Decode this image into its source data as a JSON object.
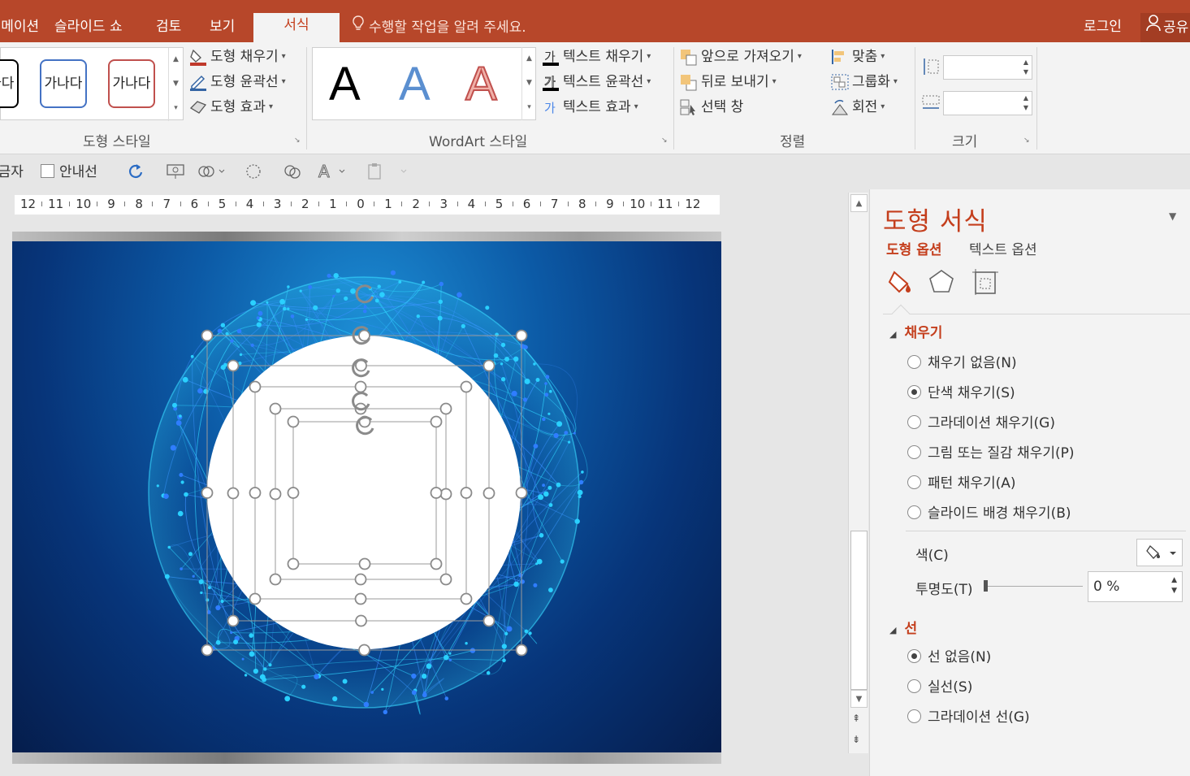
{
  "tabs": [
    {
      "label": "애니메이션"
    },
    {
      "label": "슬라이드 쇼"
    },
    {
      "label": "검토"
    },
    {
      "label": "보기"
    },
    {
      "label": "서식",
      "active": true
    }
  ],
  "tell_me": "수행할 작업을 알려 주세요.",
  "login": "로그인",
  "share": "공유",
  "ribbon": {
    "shape_styles": {
      "swatches": [
        "가나다",
        "가나다",
        "가나다"
      ],
      "fill": "도형 채우기",
      "outline": "도형 윤곽선",
      "effects": "도형 효과",
      "label": "도형 스타일"
    },
    "wordart": {
      "letters": [
        "A",
        "A",
        "A"
      ],
      "text_fill": "텍스트 채우기",
      "text_outline": "텍스트 윤곽선",
      "text_effects": "텍스트 효과",
      "label": "WordArt 스타일"
    },
    "arrange": {
      "bring_forward": "앞으로 가져오기",
      "send_backward": "뒤로 보내기",
      "selection_pane": "선택 창",
      "align": "맞춤",
      "group": "그룹화",
      "rotate": "회전",
      "label": "정렬"
    },
    "size": {
      "height": "",
      "width": "",
      "label": "크기"
    }
  },
  "qat": {
    "item1": "눈금자",
    "guides": "안내선"
  },
  "ruler": [
    "12",
    "11",
    "10",
    "9",
    "8",
    "7",
    "6",
    "5",
    "4",
    "3",
    "2",
    "1",
    "0",
    "1",
    "2",
    "3",
    "4",
    "5",
    "6",
    "7",
    "8",
    "9",
    "10",
    "11",
    "12"
  ],
  "pane": {
    "title": "도형 서식",
    "tab_shape": "도형 옵션",
    "tab_text": "텍스트 옵션",
    "fill_section": "채우기",
    "fill_options": [
      {
        "label": "채우기 없음(N)",
        "selected": false
      },
      {
        "label": "단색 채우기(S)",
        "selected": true
      },
      {
        "label": "그라데이션 채우기(G)",
        "selected": false
      },
      {
        "label": "그림 또는 질감 채우기(P)",
        "selected": false
      },
      {
        "label": "패턴 채우기(A)",
        "selected": false
      },
      {
        "label": "슬라이드 배경 채우기(B)",
        "selected": false
      }
    ],
    "color_label": "색(C)",
    "transparency_label": "투명도(T)",
    "transparency_value": "0 %",
    "line_section": "선",
    "line_options": [
      {
        "label": "선 없음(N)",
        "selected": true
      },
      {
        "label": "실선(S)",
        "selected": false
      },
      {
        "label": "그라데이션 선(G)",
        "selected": false
      }
    ]
  },
  "colors": {
    "accent": "#b7472a",
    "pane_accent": "#c43e1c"
  }
}
